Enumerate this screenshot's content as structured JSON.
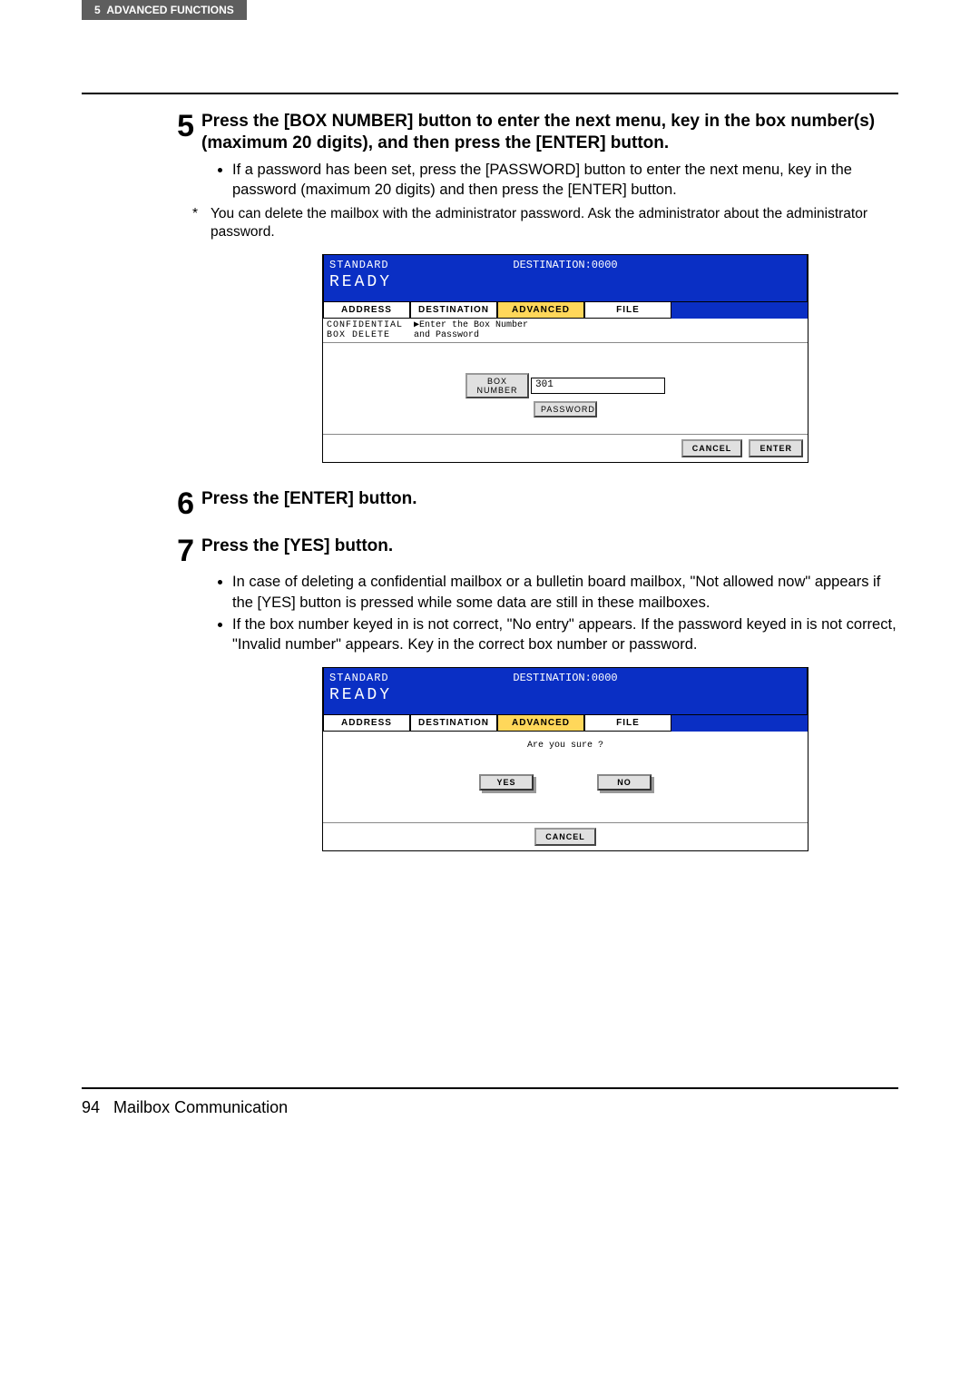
{
  "header": {
    "chapter": "5",
    "section": "ADVANCED FUNCTIONS"
  },
  "steps": {
    "s5": {
      "num": "5",
      "title": "Press the [BOX NUMBER] button to enter the next menu, key in the box number(s) (maximum 20 digits), and then press the [ENTER] button.",
      "bullets": [
        "If a password has been set, press the [PASSWORD] button to enter the next menu, key in the password (maximum 20 digits) and then press the [ENTER] button."
      ],
      "note": "You can delete the mailbox with the administrator password. Ask the administrator about the administrator password."
    },
    "s6": {
      "num": "6",
      "title": "Press the [ENTER] button."
    },
    "s7": {
      "num": "7",
      "title": "Press the [YES] button.",
      "bullets": [
        "In case of deleting a confidential mailbox or a bulletin board mailbox, \"Not allowed now\" appears if the [YES] button is pressed while some data are still in these mailboxes.",
        "If the box number keyed in is not correct, \"No entry\" appears. If the password keyed in is not correct, \"Invalid number\" appears. Key in the correct box number or password."
      ]
    }
  },
  "screen1": {
    "standard": "STANDARD",
    "destination": "DESTINATION:0000",
    "ready": "READY",
    "tabs": {
      "address": "ADDRESS",
      "destination": "DESTINATION",
      "advanced": "ADVANCED",
      "file": "FILE"
    },
    "subleft": "CONFIDENTIAL\nBOX DELETE",
    "subright": "▶Enter the Box Number\n  and Password",
    "boxnum_label": "BOX NUMBER",
    "boxnum_value": "301",
    "password_label": "PASSWORD",
    "cancel": "CANCEL",
    "enter": "ENTER"
  },
  "screen2": {
    "standard": "STANDARD",
    "destination": "DESTINATION:0000",
    "ready": "READY",
    "tabs": {
      "address": "ADDRESS",
      "destination": "DESTINATION",
      "advanced": "ADVANCED",
      "file": "FILE"
    },
    "prompt": "Are you sure ?",
    "yes": "YES",
    "no": "NO",
    "cancel": "CANCEL"
  },
  "footer": {
    "page": "94",
    "title": "Mailbox Communication"
  }
}
